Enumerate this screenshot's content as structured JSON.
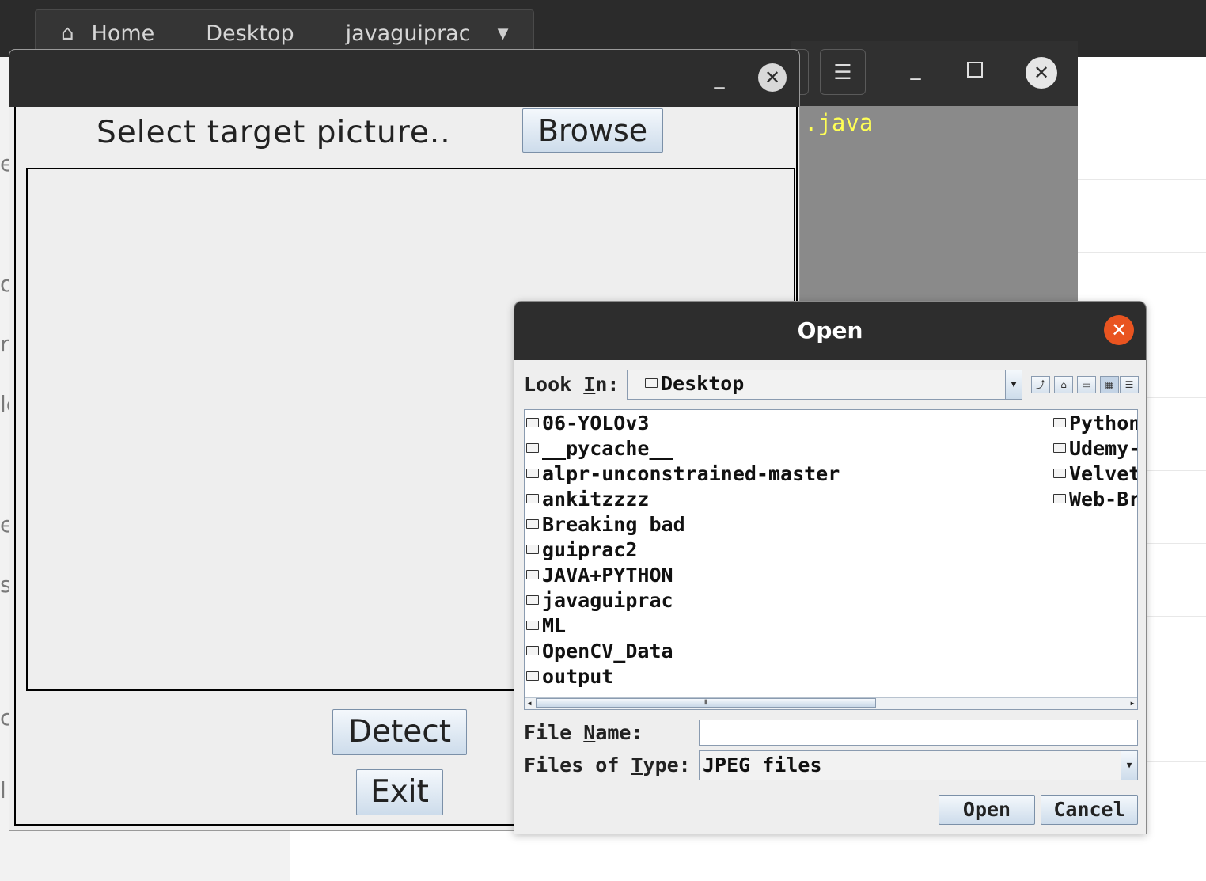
{
  "file_manager": {
    "tabs": [
      {
        "label": "Home",
        "icon": "home-icon"
      },
      {
        "label": "Desktop"
      },
      {
        "label": "javaguiprac",
        "icon": "chevron-down-icon"
      }
    ],
    "sidebar_fragments": [
      "e",
      "o",
      "n",
      "lo",
      "e",
      "s",
      "ci",
      "l"
    ]
  },
  "terminal": {
    "menu_icon": "hamburger-icon",
    "visible_text": ".java",
    "text_color": "#ffff55"
  },
  "main_window": {
    "select_label": "Select target picture..",
    "browse_label": "Browse",
    "detect_label": "Detect",
    "exit_label": "Exit"
  },
  "open_dialog": {
    "title": "Open",
    "look_in": {
      "pre": "Look ",
      "mnemonic": "I",
      "post": "n:"
    },
    "look_in_value": "Desktop",
    "toolbar_icons": [
      "up-folder-icon",
      "home-folder-icon",
      "new-folder-icon",
      "list-view-icon",
      "details-view-icon"
    ],
    "files_col1": [
      "06-YOLOv3",
      "__pycache__",
      "alpr-unconstrained-master",
      "ankitzzzz",
      "Breaking bad",
      "guiprac2",
      "JAVA+PYTHON",
      "javaguiprac",
      "ML",
      "OpenCV_Data",
      "output"
    ],
    "files_col2": [
      "Python",
      "Udemy-",
      "Velvet",
      "Web-Br"
    ],
    "file_name": {
      "pre": "File ",
      "mnemonic": "N",
      "post": "ame:"
    },
    "file_name_value": "",
    "files_of_type": {
      "pre": "Files of ",
      "mnemonic": "T",
      "post": "ype:"
    },
    "files_of_type_value": "JPEG files",
    "open_label": "Open",
    "cancel_label": "Cancel",
    "close_color": "#e95420"
  }
}
